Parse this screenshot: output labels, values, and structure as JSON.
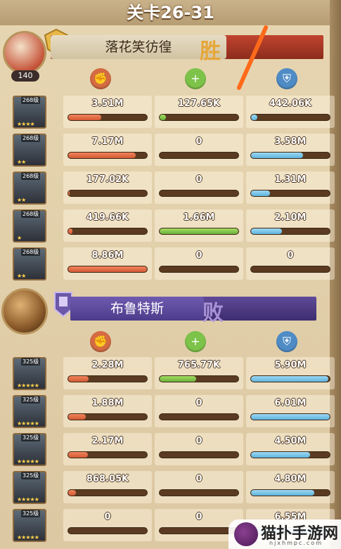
{
  "title": "关卡26-31",
  "teams": [
    {
      "name": "落花笑彷徨",
      "result": "胜",
      "result_color": "#e6a73a",
      "hero_level": "140",
      "banner_color": "#b33a27",
      "rows": [
        {
          "level": "268级",
          "stars": "★★★★",
          "dmg": "3.51M",
          "heal": "127.65K",
          "shield": "442.06K",
          "dmg_pct": 0.42,
          "heal_pct": 0.08,
          "shield_pct": 0.08
        },
        {
          "level": "268级",
          "stars": "★★",
          "dmg": "7.17M",
          "heal": "0",
          "shield": "3.58M",
          "dmg_pct": 0.86,
          "heal_pct": 0,
          "shield_pct": 0.66
        },
        {
          "level": "268级",
          "stars": "★★",
          "dmg": "177.02K",
          "heal": "0",
          "shield": "1.31M",
          "dmg_pct": 0.02,
          "heal_pct": 0,
          "shield_pct": 0.24
        },
        {
          "level": "268级",
          "stars": "★",
          "dmg": "419.66K",
          "heal": "1.66M",
          "shield": "2.10M",
          "dmg_pct": 0.05,
          "heal_pct": 1.0,
          "shield_pct": 0.39
        },
        {
          "level": "268级",
          "stars": "★★",
          "dmg": "8.86M",
          "heal": "0",
          "shield": "0",
          "dmg_pct": 1.0,
          "heal_pct": 0,
          "shield_pct": 0
        }
      ]
    },
    {
      "name": "布鲁特斯",
      "result": "败",
      "result_color": "#a992d6",
      "banner_color": "#4b3a82",
      "rows": [
        {
          "level": "325级",
          "stars": "★★★★★",
          "dmg": "2.28M",
          "heal": "765.77K",
          "shield": "5.90M",
          "dmg_pct": 0.26,
          "heal_pct": 0.46,
          "shield_pct": 0.98
        },
        {
          "level": "325级",
          "stars": "★★★★★",
          "dmg": "1.88M",
          "heal": "0",
          "shield": "6.01M",
          "dmg_pct": 0.22,
          "heal_pct": 0,
          "shield_pct": 1.0
        },
        {
          "level": "325级",
          "stars": "★★★★★",
          "dmg": "2.17M",
          "heal": "0",
          "shield": "4.50M",
          "dmg_pct": 0.25,
          "heal_pct": 0,
          "shield_pct": 0.75
        },
        {
          "level": "325级",
          "stars": "★★★★★",
          "dmg": "868.05K",
          "heal": "0",
          "shield": "4.80M",
          "dmg_pct": 0.1,
          "heal_pct": 0,
          "shield_pct": 0.8
        },
        {
          "level": "325级",
          "stars": "★★★★★",
          "dmg": "0",
          "heal": "0",
          "shield": "6.55M",
          "dmg_pct": 0,
          "heal_pct": 0,
          "shield_pct": 1.0
        }
      ]
    }
  ],
  "watermark": {
    "text": "猫扑手游网",
    "sub": "njxhmpc.com"
  },
  "colors": {
    "dmg": "#d35a35",
    "heal": "#6bb23a",
    "shield": "#5fb4de",
    "bar_bg": "#5a3b21"
  },
  "icons": {
    "dmg": "fist-icon",
    "heal": "heal-plus-icon",
    "shield": "shield-icon"
  }
}
